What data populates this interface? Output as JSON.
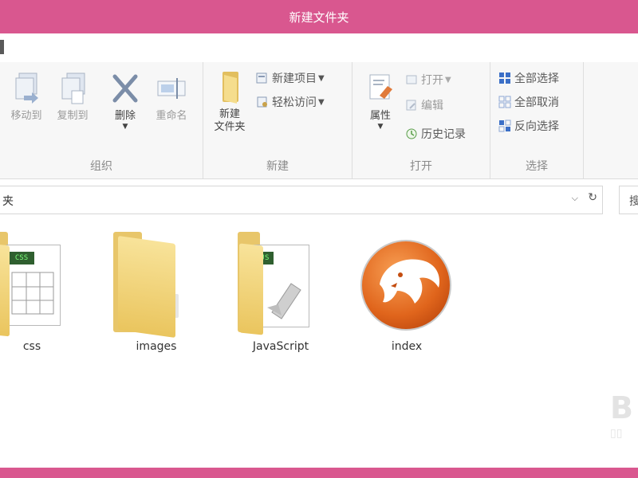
{
  "window": {
    "title": "新建文件夹"
  },
  "ribbon": {
    "organize": {
      "label": "组织",
      "move_to": "移动到",
      "copy_to": "复制到",
      "delete": "删除",
      "rename": "重命名"
    },
    "new": {
      "label": "新建",
      "new_folder_line1": "新建",
      "new_folder_line2": "文件夹",
      "new_item": "新建项目",
      "easy_access": "轻松访问"
    },
    "open": {
      "label": "打开",
      "properties": "属性",
      "open": "打开",
      "edit": "编辑",
      "history": "历史记录"
    },
    "select": {
      "label": "选择",
      "select_all": "全部选择",
      "select_none": "全部取消",
      "invert": "反向选择"
    }
  },
  "address": {
    "path": "夹",
    "search_placeholder": "搜"
  },
  "files": [
    {
      "name": "css",
      "type": "folder-css"
    },
    {
      "name": "images",
      "type": "folder"
    },
    {
      "name": "JavaScript",
      "type": "folder-js"
    },
    {
      "name": "index",
      "type": "browser-file"
    }
  ],
  "colors": {
    "titlebar": "#d9578f",
    "accent": "#3b6fc7"
  }
}
